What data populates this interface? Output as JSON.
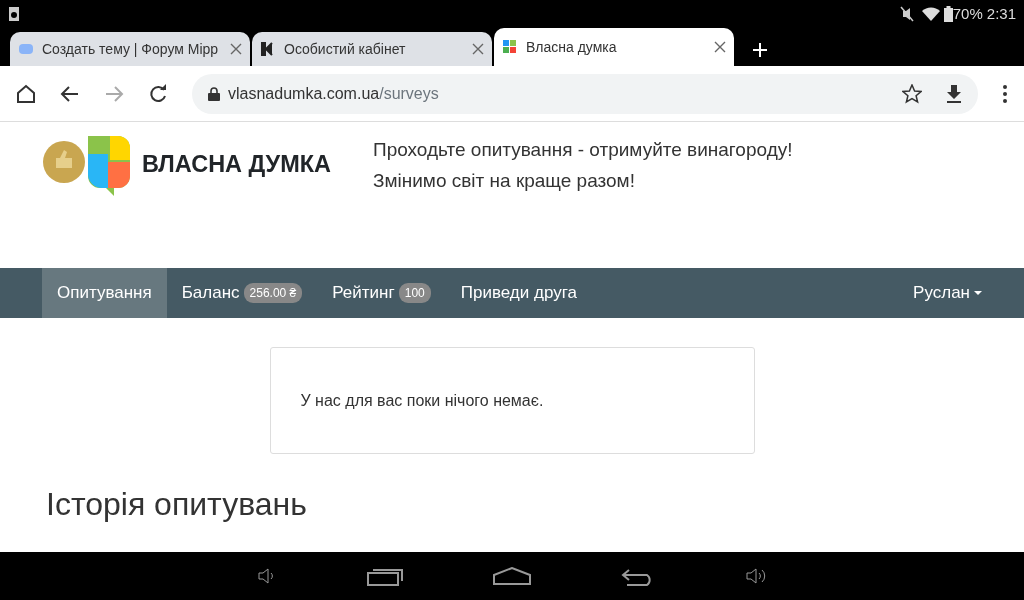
{
  "status_bar": {
    "battery": "70%",
    "time": "2:31"
  },
  "browser_tabs": [
    {
      "title": "Создать тему | Форум Mipp",
      "selected": false
    },
    {
      "title": "Особистий кабінет",
      "selected": false
    },
    {
      "title": "Власна думка",
      "selected": true
    }
  ],
  "address_bar": {
    "domain": "vlasnadumka.com.ua",
    "path": "/surveys"
  },
  "site_header": {
    "logo_text": "ВЛАСНА ДУМКА",
    "tagline": [
      "Проходьте опитування - отримуйте винагороду!",
      "Змінимо світ на краще разом!"
    ]
  },
  "nav": {
    "items": [
      {
        "label": "Опитування",
        "selected": true
      },
      {
        "label": "Баланс",
        "badge": "256.00 ₴",
        "selected": false
      },
      {
        "label": "Рейтинг",
        "badge": "100",
        "selected": false
      },
      {
        "label": "Приведи друга",
        "selected": false
      }
    ],
    "user": "Руслан"
  },
  "notice": "У нас для вас поки нічого немає.",
  "history": {
    "title": "Історія опитувань"
  }
}
